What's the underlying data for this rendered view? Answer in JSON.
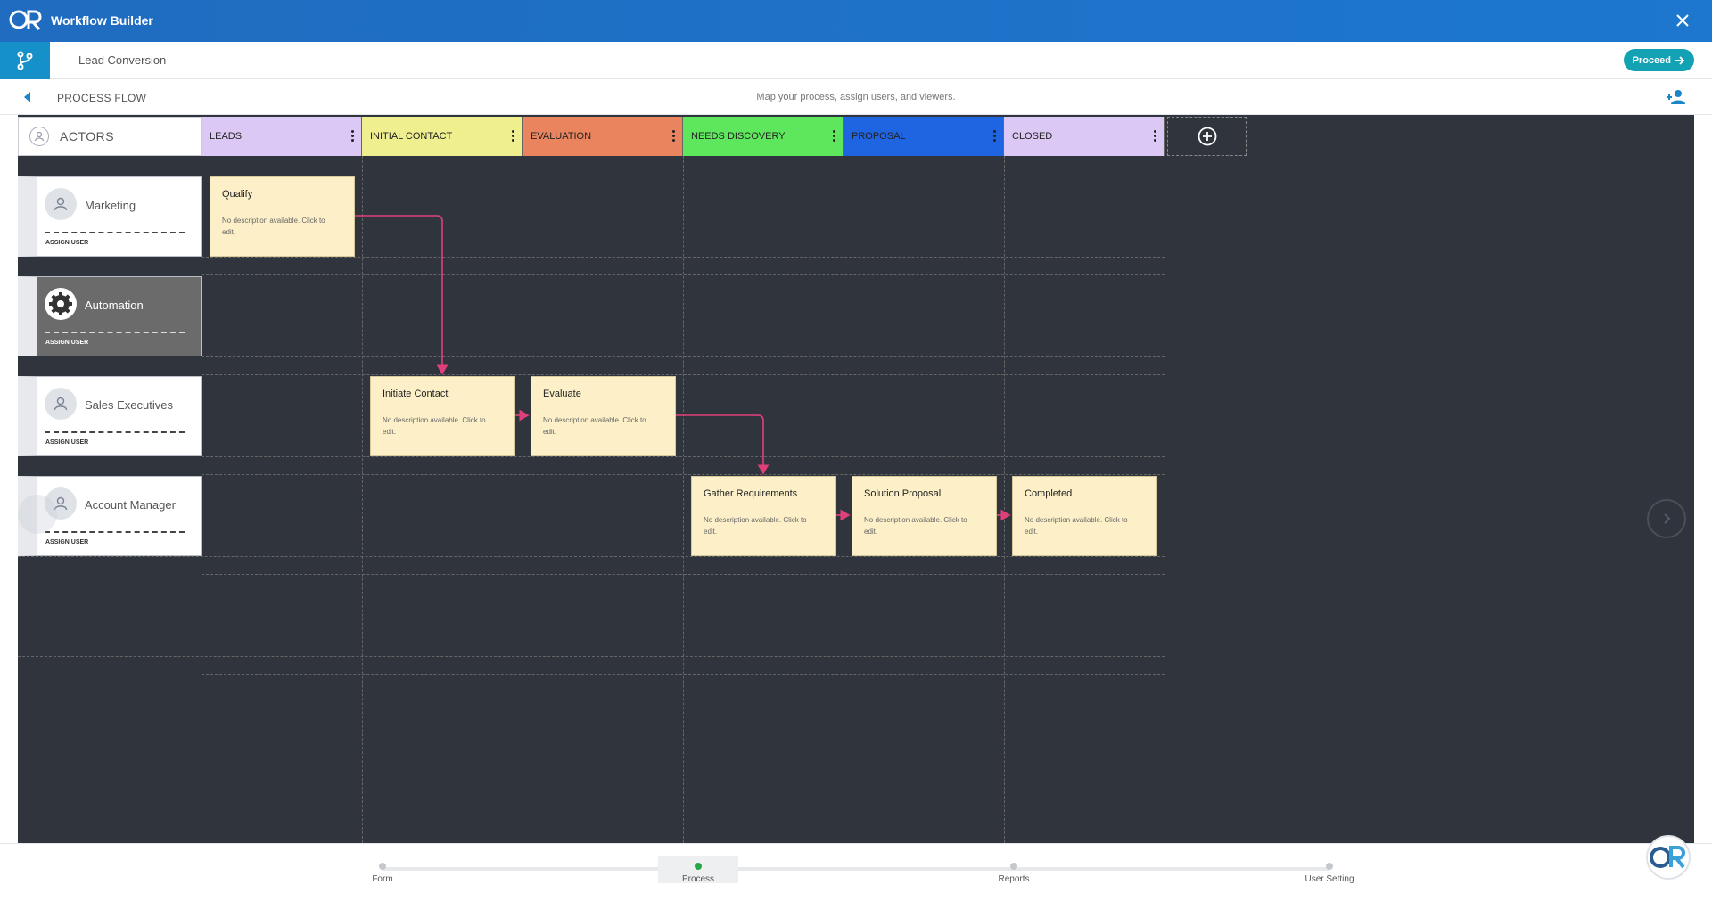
{
  "app": {
    "title": "Workflow Builder"
  },
  "workflow": {
    "name": "Lead Conversion",
    "proceed_label": "Proceed"
  },
  "process_flow": {
    "title": "PROCESS FLOW",
    "hint": "Map your process, assign users, and viewers."
  },
  "board": {
    "actors_label": "ACTORS",
    "stages": [
      {
        "name": "LEADS",
        "color": "#dcc8f5"
      },
      {
        "name": "INITIAL CONTACT",
        "color": "#f0ef8f"
      },
      {
        "name": "EVALUATION",
        "color": "#e9845f"
      },
      {
        "name": "NEEDS DISCOVERY",
        "color": "#5ee65c"
      },
      {
        "name": "PROPOSAL",
        "color": "#1f64e0"
      },
      {
        "name": "CLOSED",
        "color": "#dcc8f5"
      }
    ],
    "actors": [
      {
        "name": "Marketing",
        "assign": "ASSIGN USER",
        "icon": "user-icon"
      },
      {
        "name": "Automation",
        "assign": "ASSIGN USER",
        "icon": "gear-icon"
      },
      {
        "name": "Sales Executives",
        "assign": "ASSIGN USER",
        "icon": "user-icon"
      },
      {
        "name": "Account Manager",
        "assign": "ASSIGN USER",
        "icon": "user-icon"
      }
    ],
    "cards": [
      {
        "title": "Qualify",
        "desc": "No description available. Click to edit.",
        "stage": "LEADS",
        "actor": "Marketing"
      },
      {
        "title": "Initiate Contact",
        "desc": "No description available. Click to edit.",
        "stage": "INITIAL CONTACT",
        "actor": "Sales Executives"
      },
      {
        "title": "Evaluate",
        "desc": "No description available. Click to edit.",
        "stage": "EVALUATION",
        "actor": "Sales Executives"
      },
      {
        "title": "Gather Requirements",
        "desc": "No description available. Click to edit.",
        "stage": "NEEDS DISCOVERY",
        "actor": "Account Manager"
      },
      {
        "title": "Solution Proposal",
        "desc": "No description available. Click to edit.",
        "stage": "PROPOSAL",
        "actor": "Account Manager"
      },
      {
        "title": "Completed",
        "desc": "No description available. Click to edit.",
        "stage": "CLOSED",
        "actor": "Account Manager"
      }
    ],
    "connector_color": "#e0407a"
  },
  "stepper": {
    "steps": [
      {
        "label": "Form",
        "active": false
      },
      {
        "label": "Process",
        "active": true
      },
      {
        "label": "Reports",
        "active": false
      },
      {
        "label": "User Setting",
        "active": false
      }
    ]
  }
}
